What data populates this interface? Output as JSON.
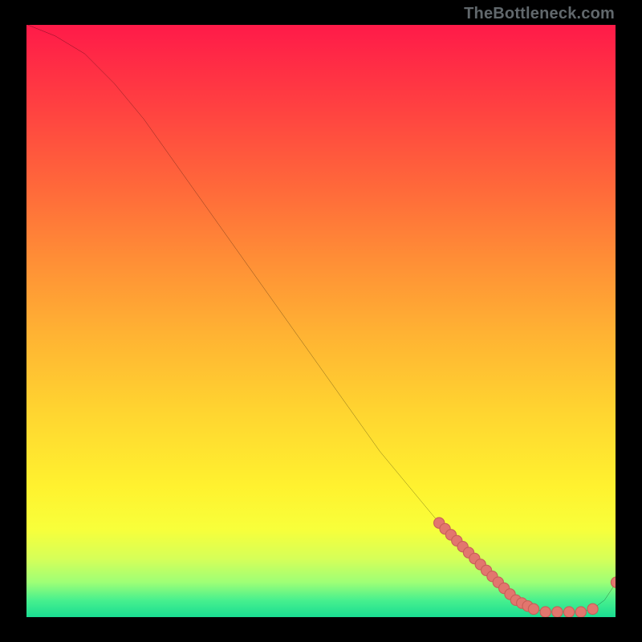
{
  "watermark": "TheBottleneck.com",
  "colors": {
    "curve_stroke": "#000000",
    "point_fill": "#e2766e",
    "point_stroke": "#c85f58",
    "gradient_top": "#ff1a49",
    "gradient_bottom": "#17dc92",
    "background": "#000000"
  },
  "chart_data": {
    "type": "line",
    "title": "",
    "xlabel": "",
    "ylabel": "",
    "xlim": [
      0,
      100
    ],
    "ylim": [
      0,
      100
    ],
    "grid": false,
    "legend": false,
    "series": [
      {
        "name": "bottleneck-curve",
        "x": [
          0,
          5,
          10,
          15,
          20,
          25,
          30,
          35,
          40,
          45,
          50,
          55,
          60,
          65,
          70,
          72,
          74,
          76,
          78,
          80,
          82,
          84,
          86,
          88,
          90,
          92,
          94,
          96,
          98,
          100
        ],
        "y": [
          100,
          98,
          95,
          90,
          84,
          77,
          70,
          63,
          56,
          49,
          42,
          35,
          28,
          22,
          16,
          14,
          12,
          10,
          8,
          6,
          4,
          2.5,
          1.5,
          1,
          1,
          1,
          1,
          1.5,
          3,
          6
        ]
      }
    ],
    "highlight_points": {
      "name": "sampled-configs",
      "x": [
        70,
        71,
        72,
        73,
        74,
        75,
        76,
        77,
        78,
        79,
        80,
        81,
        82,
        83,
        84,
        85,
        86,
        88,
        90,
        92,
        94,
        96,
        100
      ],
      "y": [
        16,
        15,
        14,
        13,
        12,
        11,
        10,
        9,
        8,
        7,
        6,
        5,
        4,
        3,
        2.5,
        2,
        1.5,
        1,
        1,
        1,
        1,
        1.5,
        6
      ]
    }
  }
}
